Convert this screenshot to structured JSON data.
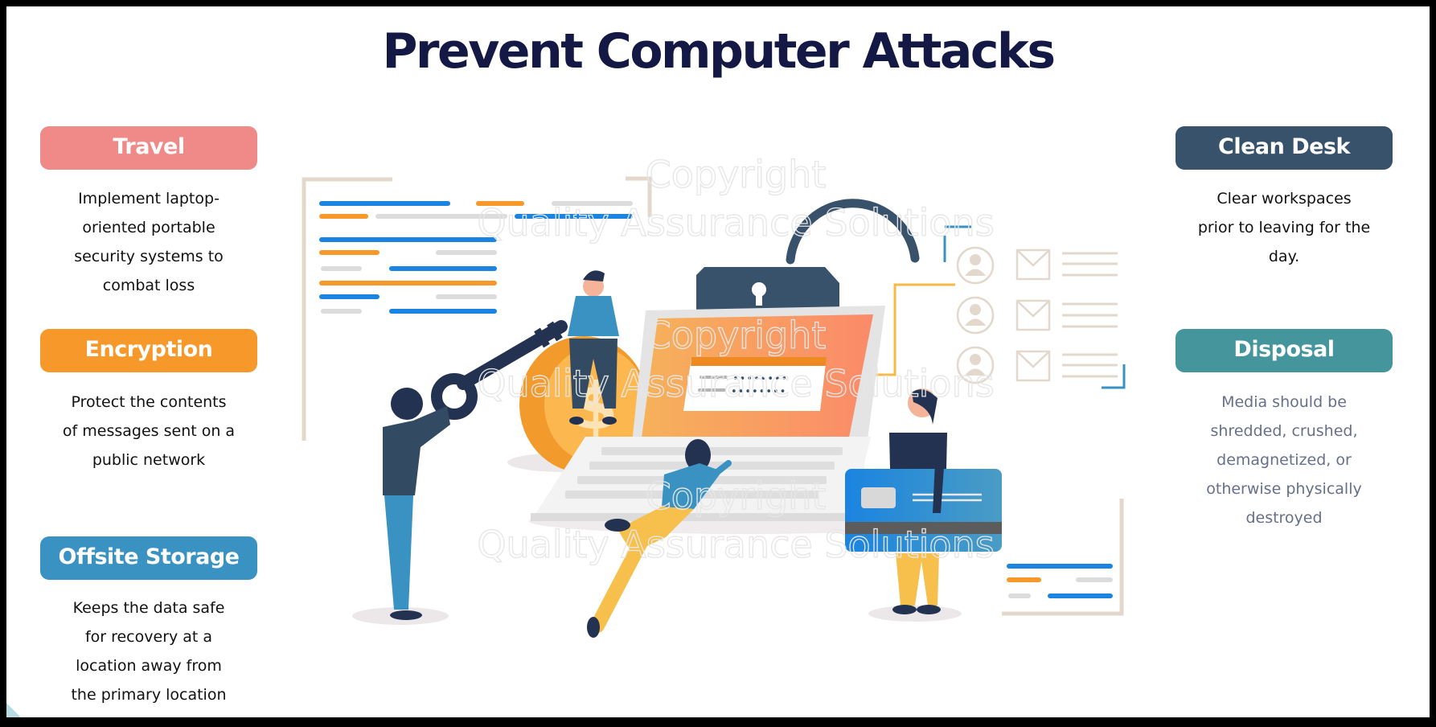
{
  "title": "Prevent Computer Attacks",
  "colors": {
    "title": "#141845",
    "travel": "#f08a88",
    "encryption": "#f7982a",
    "offsite_storage": "#3a92c2",
    "clean_desk": "#38526b",
    "disposal": "#44959c",
    "frame": "#000000"
  },
  "left_items": [
    {
      "label": "Travel",
      "description": [
        "Implement  laptop-",
        "oriented portable",
        "security systems to",
        "combat loss"
      ]
    },
    {
      "label": "Encryption",
      "description": [
        "Protect the contents",
        "of messages sent on a",
        "public network"
      ]
    },
    {
      "label": "Offsite Storage",
      "description": [
        "Keeps the data safe",
        "for recovery at a",
        "location away from",
        "the primary location"
      ]
    }
  ],
  "right_items": [
    {
      "label": "Clean Desk",
      "description": [
        "Clear workspaces",
        "prior to leaving for the",
        "day."
      ]
    },
    {
      "label": "Disposal",
      "description": [
        "Media should be",
        "shredded, crushed,",
        "demagnetized, or",
        "otherwise physically",
        "destroyed"
      ]
    }
  ],
  "illustration": {
    "watermark_line1": "Copyright",
    "watermark_line2": "Quality Assurance Solutions",
    "password_mask": "••••••••",
    "coin_symbol": "$"
  }
}
